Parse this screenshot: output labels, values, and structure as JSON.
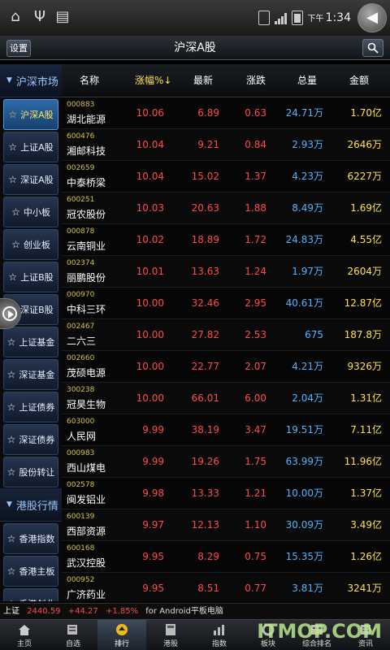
{
  "statusbar": {
    "clock_ampm": "下午",
    "clock_time": "1:34"
  },
  "header": {
    "settings_label": "设置",
    "title": "沪深A股"
  },
  "sidebar": {
    "sections": [
      {
        "label": "沪深市场",
        "items": [
          "沪深A股",
          "上证A股",
          "深证A股",
          "中小板",
          "创业板",
          "上证B股",
          "深证B股",
          "上证基金",
          "深证基金",
          "上证债券",
          "深证债券",
          "股份转让"
        ]
      },
      {
        "label": "港股行情",
        "items": [
          "香港指数",
          "香港主板",
          "香港创业"
        ]
      }
    ]
  },
  "columns": {
    "name": "名称",
    "change_pct": "涨幅%↓",
    "latest": "最新",
    "change": "涨跌",
    "volume": "总量",
    "amount": "金额"
  },
  "rows": [
    {
      "code": "000883",
      "name": "湖北能源",
      "pct": "10.06",
      "latest": "6.89",
      "chg": "0.63",
      "vol": "24.71万",
      "amt": "1.70亿"
    },
    {
      "code": "600476",
      "name": "湘邮科技",
      "pct": "10.04",
      "latest": "9.21",
      "chg": "0.84",
      "vol": "2.93万",
      "amt": "2646万"
    },
    {
      "code": "002659",
      "name": "中泰桥梁",
      "pct": "10.04",
      "latest": "15.02",
      "chg": "1.37",
      "vol": "4.23万",
      "amt": "6227万"
    },
    {
      "code": "600251",
      "name": "冠农股份",
      "pct": "10.03",
      "latest": "20.63",
      "chg": "1.88",
      "vol": "8.49万",
      "amt": "1.69亿"
    },
    {
      "code": "000878",
      "name": "云南铜业",
      "pct": "10.02",
      "latest": "18.89",
      "chg": "1.72",
      "vol": "24.83万",
      "amt": "4.55亿"
    },
    {
      "code": "002374",
      "name": "丽鹏股份",
      "pct": "10.01",
      "latest": "13.63",
      "chg": "1.24",
      "vol": "1.97万",
      "amt": "2604万"
    },
    {
      "code": "000970",
      "name": "中科三环",
      "pct": "10.00",
      "latest": "32.46",
      "chg": "2.95",
      "vol": "40.61万",
      "amt": "12.87亿"
    },
    {
      "code": "002467",
      "name": "二六三",
      "pct": "10.00",
      "latest": "27.82",
      "chg": "2.53",
      "vol": "675",
      "amt": "187.8万"
    },
    {
      "code": "002660",
      "name": "茂硕电源",
      "pct": "10.00",
      "latest": "22.77",
      "chg": "2.07",
      "vol": "4.21万",
      "amt": "9326万"
    },
    {
      "code": "300238",
      "name": "冠昊生物",
      "pct": "10.00",
      "latest": "66.01",
      "chg": "6.00",
      "vol": "2.04万",
      "amt": "1.31亿"
    },
    {
      "code": "603000",
      "name": "人民网",
      "pct": "9.99",
      "latest": "38.19",
      "chg": "3.47",
      "vol": "19.51万",
      "amt": "7.11亿"
    },
    {
      "code": "000983",
      "name": "西山煤电",
      "pct": "9.99",
      "latest": "19.26",
      "chg": "1.75",
      "vol": "63.99万",
      "amt": "11.96亿"
    },
    {
      "code": "002578",
      "name": "闽发铝业",
      "pct": "9.98",
      "latest": "13.33",
      "chg": "1.21",
      "vol": "10.00万",
      "amt": "1.37亿"
    },
    {
      "code": "600139",
      "name": "西部资源",
      "pct": "9.97",
      "latest": "12.13",
      "chg": "1.10",
      "vol": "30.09万",
      "amt": "3.49亿"
    },
    {
      "code": "600168",
      "name": "武汉控股",
      "pct": "9.95",
      "latest": "8.29",
      "chg": "0.75",
      "vol": "15.35万",
      "amt": "1.26亿"
    },
    {
      "code": "000952",
      "name": "广济药业",
      "pct": "9.95",
      "latest": "8.51",
      "chg": "0.77",
      "vol": "3.81万",
      "amt": "3241万"
    }
  ],
  "ticker": {
    "index": "上证",
    "value": "2440.59",
    "change": "+44.27",
    "pct": "+1.85%",
    "app": "for Android平板电脑"
  },
  "bottomnav": [
    {
      "label": "主页",
      "icon": "home-icon"
    },
    {
      "label": "自选",
      "icon": "favorites-icon"
    },
    {
      "label": "排行",
      "icon": "ranking-icon"
    },
    {
      "label": "港股",
      "icon": "hk-stock-icon"
    },
    {
      "label": "指数",
      "icon": "index-icon"
    },
    {
      "label": "板块",
      "icon": "sector-icon"
    },
    {
      "label": "综合排名",
      "icon": "overall-ranking-icon"
    },
    {
      "label": "资讯",
      "icon": "news-icon"
    }
  ],
  "watermark": "ITMOP.COM",
  "colors": {
    "up": "#ff4a4a",
    "volume": "#4fb4ff",
    "amount": "#ffe14d",
    "code": "#d9c04a"
  }
}
